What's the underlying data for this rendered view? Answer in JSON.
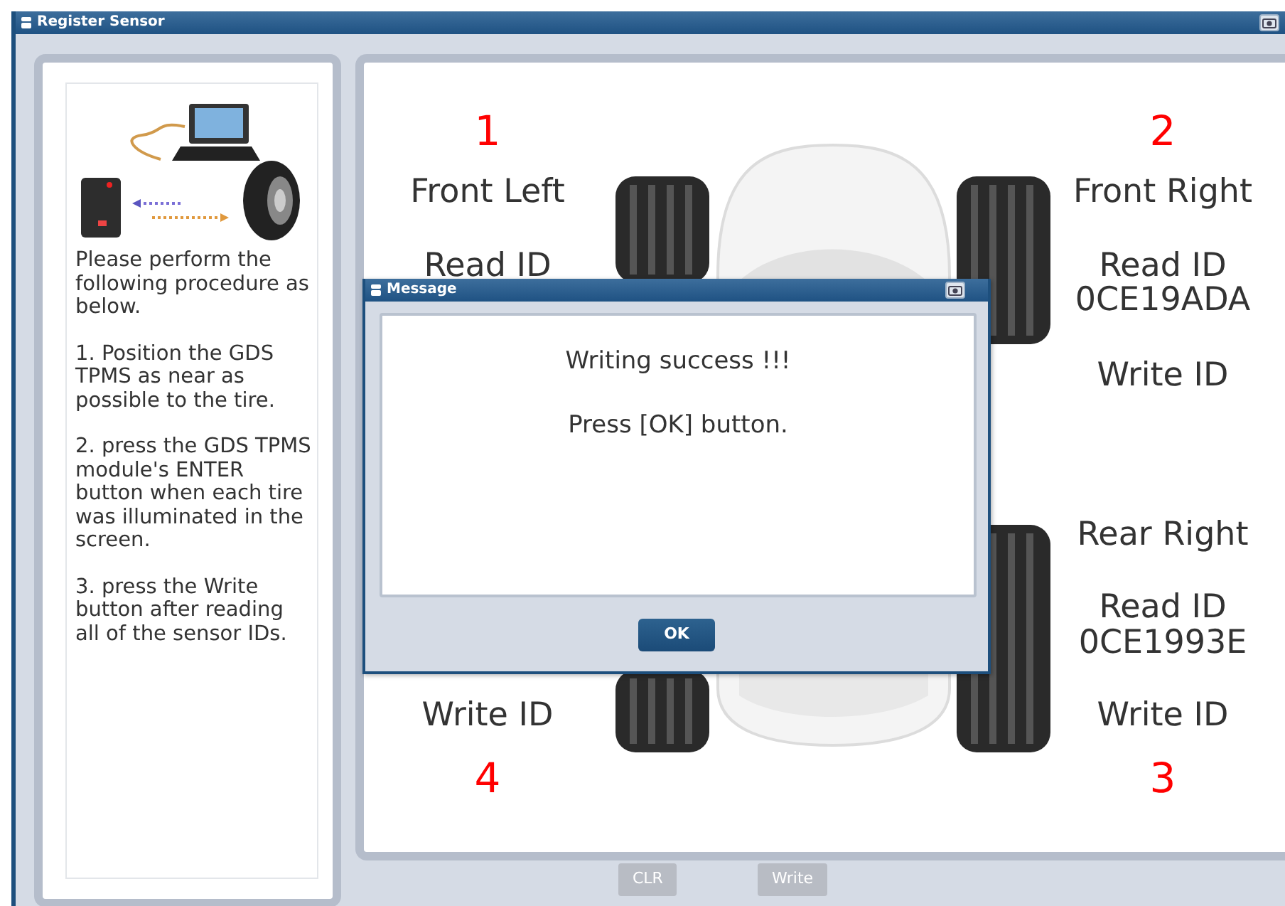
{
  "window": {
    "title": "Register Sensor"
  },
  "instructions": [
    "Please perform the following procedure as below.",
    "1. Position the GDS TPMS as near as possible to the tire.",
    "2. press the GDS TPMS module's ENTER button when each tire was illuminated in the screen.",
    "3. press the Write button after reading all of the sensor IDs."
  ],
  "left_wheels": [
    {
      "kind": "front",
      "number": "1",
      "position": "Front Left",
      "read_label": "Read ID"
    },
    {
      "kind": "rear",
      "write_label": "Write ID",
      "number": "4"
    }
  ],
  "right_wheels": [
    {
      "kind": "front",
      "number": "2",
      "position": "Front Right",
      "read_label": "Read ID",
      "read_value": "0CE19ADA",
      "write_label": "Write ID"
    },
    {
      "kind": "rear",
      "position": "Rear Right",
      "read_label": "Read ID",
      "read_value": "0CE1993E",
      "write_label": "Write ID",
      "number": "3"
    }
  ],
  "buttons": [
    {
      "label": "CLR",
      "disabled": true
    },
    {
      "label": "Write",
      "disabled": true
    }
  ],
  "dialog": {
    "title": "Message",
    "lines": [
      "Writing success !!!",
      "Press [OK] button."
    ],
    "button": "OK"
  }
}
